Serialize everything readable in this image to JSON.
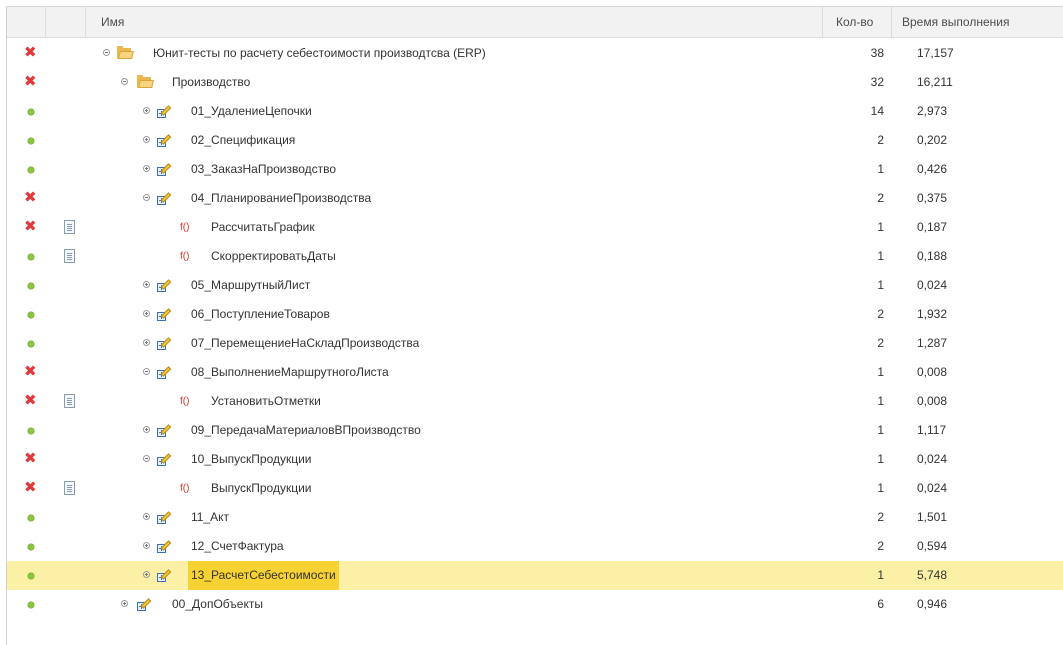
{
  "columns": {
    "name": "Имя",
    "count": "Кол-во",
    "time": "Время выполнения"
  },
  "rows": [
    {
      "status": "error",
      "doc": false,
      "toggle": "minus",
      "icon": "folder-open-icon",
      "level": 0,
      "name": "Юнит-тесты по расчету себестоимости производтсва (ERP)",
      "count": "38",
      "time": "17,157"
    },
    {
      "status": "error",
      "doc": false,
      "toggle": "minus",
      "icon": "folder-open-icon",
      "level": 1,
      "name": "Производство",
      "count": "32",
      "time": "16,211"
    },
    {
      "status": "ok",
      "doc": false,
      "toggle": "plus",
      "icon": "test-module-icon",
      "level": 2,
      "name": "01_УдалениеЦепочки",
      "count": "14",
      "time": "2,973"
    },
    {
      "status": "ok",
      "doc": false,
      "toggle": "plus",
      "icon": "test-module-icon",
      "level": 2,
      "name": "02_Спецификация",
      "count": "2",
      "time": "0,202"
    },
    {
      "status": "ok",
      "doc": false,
      "toggle": "plus",
      "icon": "test-module-icon",
      "level": 2,
      "name": "03_ЗаказНаПроизводство",
      "count": "1",
      "time": "0,426"
    },
    {
      "status": "error",
      "doc": false,
      "toggle": "minus",
      "icon": "test-module-icon",
      "level": 2,
      "name": "04_ПланированиеПроизводства",
      "count": "2",
      "time": "0,375"
    },
    {
      "status": "error",
      "doc": true,
      "toggle": "",
      "icon": "function-icon",
      "level": 3,
      "name": "РассчитатьГрафик",
      "count": "1",
      "time": "0,187"
    },
    {
      "status": "ok",
      "doc": true,
      "toggle": "",
      "icon": "function-icon",
      "level": 3,
      "name": "СкорректироватьДаты",
      "count": "1",
      "time": "0,188"
    },
    {
      "status": "ok",
      "doc": false,
      "toggle": "plus",
      "icon": "test-module-icon",
      "level": 2,
      "name": "05_МаршрутныйЛист",
      "count": "1",
      "time": "0,024"
    },
    {
      "status": "ok",
      "doc": false,
      "toggle": "plus",
      "icon": "test-module-icon",
      "level": 2,
      "name": "06_ПоступлениеТоваров",
      "count": "2",
      "time": "1,932"
    },
    {
      "status": "ok",
      "doc": false,
      "toggle": "plus",
      "icon": "test-module-icon",
      "level": 2,
      "name": "07_ПеремещениеНаСкладПроизводства",
      "count": "2",
      "time": "1,287"
    },
    {
      "status": "error",
      "doc": false,
      "toggle": "minus",
      "icon": "test-module-icon",
      "level": 2,
      "name": "08_ВыполнениеМаршрутногоЛиста",
      "count": "1",
      "time": "0,008"
    },
    {
      "status": "error",
      "doc": true,
      "toggle": "",
      "icon": "function-icon",
      "level": 3,
      "name": "УстановитьОтметки",
      "count": "1",
      "time": "0,008"
    },
    {
      "status": "ok",
      "doc": false,
      "toggle": "plus",
      "icon": "test-module-icon",
      "level": 2,
      "name": "09_ПередачаМатериаловВПроизводство",
      "count": "1",
      "time": "1,117"
    },
    {
      "status": "error",
      "doc": false,
      "toggle": "minus",
      "icon": "test-module-icon",
      "level": 2,
      "name": "10_ВыпускПродукции",
      "count": "1",
      "time": "0,024"
    },
    {
      "status": "error",
      "doc": true,
      "toggle": "",
      "icon": "function-icon",
      "level": 3,
      "name": "ВыпускПродукции",
      "count": "1",
      "time": "0,024"
    },
    {
      "status": "ok",
      "doc": false,
      "toggle": "plus",
      "icon": "test-module-icon",
      "level": 2,
      "name": "11_Акт",
      "count": "2",
      "time": "1,501"
    },
    {
      "status": "ok",
      "doc": false,
      "toggle": "plus",
      "icon": "test-module-icon",
      "level": 2,
      "name": "12_СчетФактура",
      "count": "2",
      "time": "0,594"
    },
    {
      "status": "ok",
      "doc": false,
      "toggle": "plus",
      "icon": "test-module-icon",
      "level": 2,
      "name": "13_РасчетСебестоимости",
      "count": "1",
      "time": "5,748",
      "selected": true
    },
    {
      "status": "ok",
      "doc": false,
      "toggle": "plus",
      "icon": "test-module-icon",
      "level": 1,
      "name": "00_ДопОбъекты",
      "count": "6",
      "time": "0,946"
    }
  ],
  "function_glyph": "f()",
  "error_glyph": "✖",
  "colors": {
    "ok": "#8bc63f",
    "error": "#de3a3a",
    "selected_row": "#fbf0a6",
    "selected_name": "#f8d232",
    "function": "#d0362b"
  }
}
